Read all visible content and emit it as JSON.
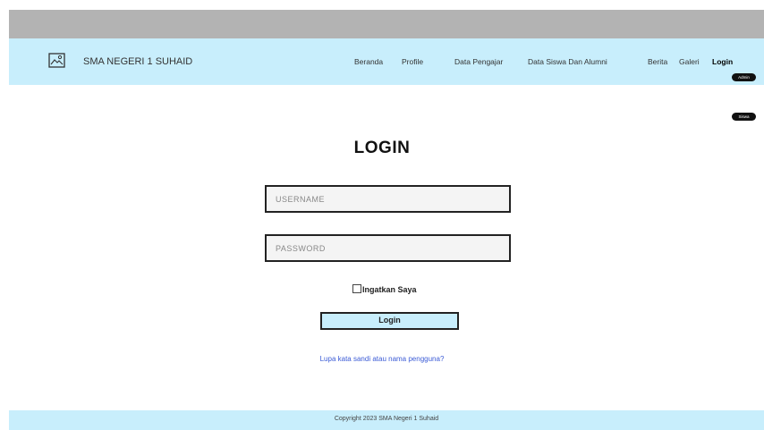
{
  "header": {
    "school_name": "SMA NEGERI 1 SUHAID",
    "logo_icon": "image-icon",
    "nav": [
      "Beranda",
      "Profile",
      "Data Pengajar",
      "Data Siswa Dan Alumni",
      "Berita",
      "Galeri",
      "Login"
    ],
    "login_options": [
      "Admin",
      "Siswa"
    ]
  },
  "form": {
    "title": "LOGIN",
    "username_placeholder": "USERNAME",
    "password_placeholder": "PASSWORD",
    "remember_label": "Ingatkan Saya",
    "login_button": "Login",
    "forgot_link": "Lupa kata sandi atau nama pengguna?"
  },
  "footer": {
    "copyright": "Copyright 2023 SMA Negeri 1 Suhaid"
  },
  "colors": {
    "topbar": "#b3b3b3",
    "navbar": "#c8eefc",
    "link": "#3b5bd6"
  }
}
